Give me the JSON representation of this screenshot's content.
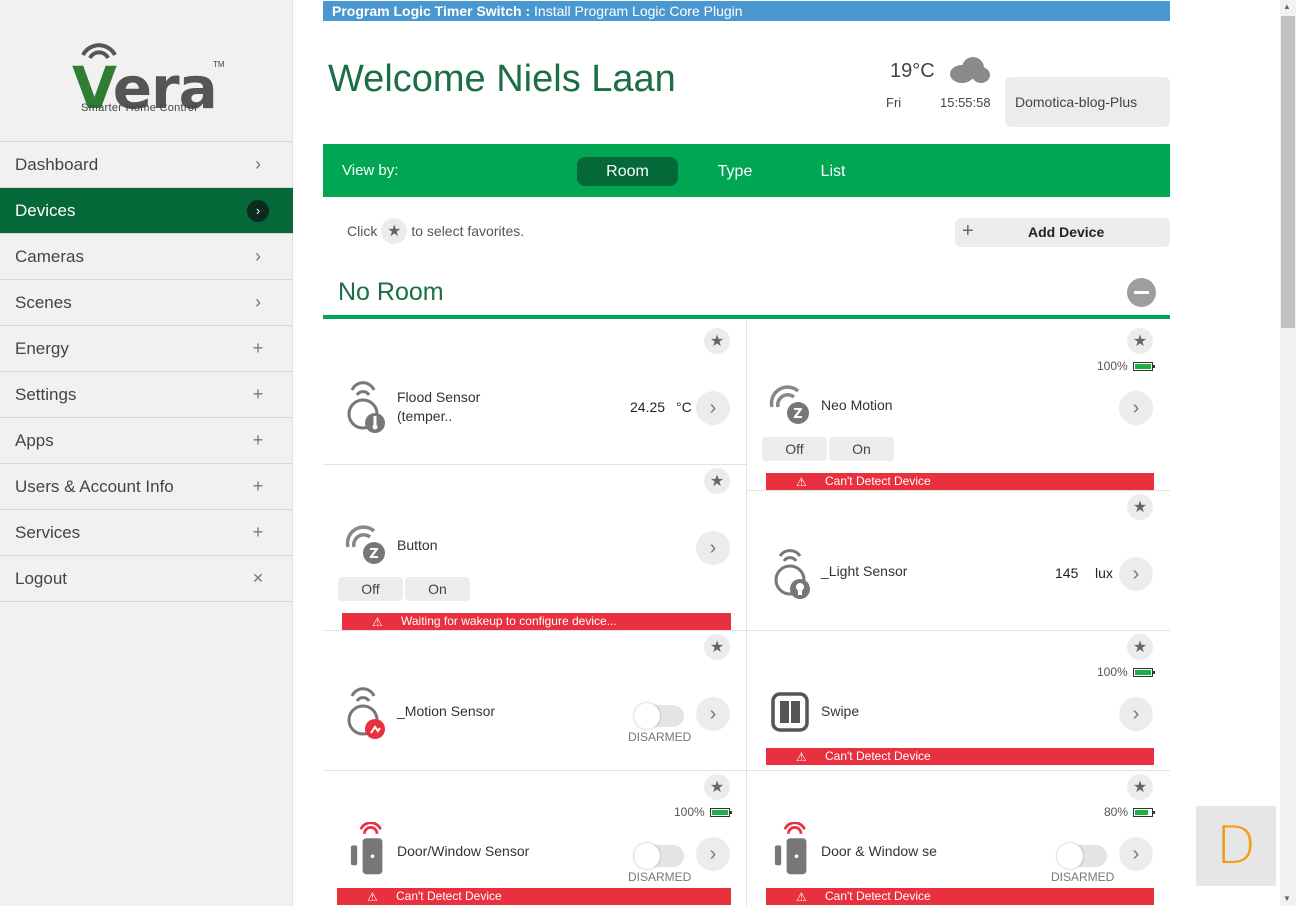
{
  "sidebar": {
    "logo": {
      "word": "era",
      "letter": "V",
      "tm": "TM",
      "tagline": "Smarter Home Control"
    },
    "items": [
      {
        "label": "Dashboard",
        "indicator": "›"
      },
      {
        "label": "Devices",
        "indicator": "›",
        "active": true
      },
      {
        "label": "Cameras",
        "indicator": "›"
      },
      {
        "label": "Scenes",
        "indicator": "›"
      },
      {
        "label": "Energy",
        "indicator": "+"
      },
      {
        "label": "Settings",
        "indicator": "+"
      },
      {
        "label": "Apps",
        "indicator": "+"
      },
      {
        "label": "Users & Account Info",
        "indicator": "+"
      },
      {
        "label": "Services",
        "indicator": "+"
      },
      {
        "label": "Logout",
        "indicator": "✕"
      }
    ]
  },
  "banner": {
    "bold": "Program Logic Timer Switch :",
    "text": " Install Program Logic Core Plugin"
  },
  "header": {
    "welcome": "Welcome Niels Laan",
    "temperature": "19°C",
    "weather_icon": "cloud-icon",
    "day": "Fri",
    "time": "15:55:58",
    "unit_name": "Domotica-blog-Plus"
  },
  "viewbar": {
    "label": "View by:",
    "tabs": [
      {
        "label": "Room",
        "active": true
      },
      {
        "label": "Type"
      },
      {
        "label": "List"
      }
    ]
  },
  "favorites_hint": {
    "before": "Click",
    "after": "to select favorites."
  },
  "add_device": {
    "plus": "+",
    "label": "Add Device"
  },
  "room": {
    "title": "No Room"
  },
  "devices": [
    {
      "name": "Flood Sensor\n(temper..",
      "reading_value": "24.25",
      "reading_unit": "°C",
      "icon": "temperature-sensor-icon"
    },
    {
      "name": "Neo Motion",
      "battery": "100%",
      "battery_level": 1.0,
      "off_label": "Off",
      "on_label": "On",
      "alert": "Can't Detect Device",
      "icon": "zwave-icon"
    },
    {
      "name": "Button",
      "off_label": "Off",
      "on_label": "On",
      "alert": "Waiting for wakeup to configure device...",
      "icon": "zwave-icon"
    },
    {
      "name": "_Light Sensor",
      "reading_value": "145",
      "reading_unit": "lux",
      "icon": "light-sensor-icon"
    },
    {
      "name": "_Motion Sensor",
      "state": "DISARMED",
      "icon": "motion-sensor-icon"
    },
    {
      "name": "Swipe",
      "battery": "100%",
      "battery_level": 1.0,
      "alert": "Can't Detect Device",
      "icon": "swipe-icon"
    },
    {
      "name": "Door/Window Sensor",
      "battery": "100%",
      "battery_level": 1.0,
      "state": "DISARMED",
      "alert": "Can't Detect Device",
      "icon": "door-sensor-icon"
    },
    {
      "name": "Door & Window se",
      "battery": "80%",
      "battery_level": 0.8,
      "state": "DISARMED",
      "alert": "Can't Detect Device",
      "icon": "door-sensor-icon"
    }
  ],
  "d_badge": "D",
  "colors": {
    "green": "#00a651",
    "dark_green": "#056839",
    "banner_blue": "#4a98d0",
    "alert_red": "#e8303e",
    "accent_orange": "#f49b1a"
  }
}
